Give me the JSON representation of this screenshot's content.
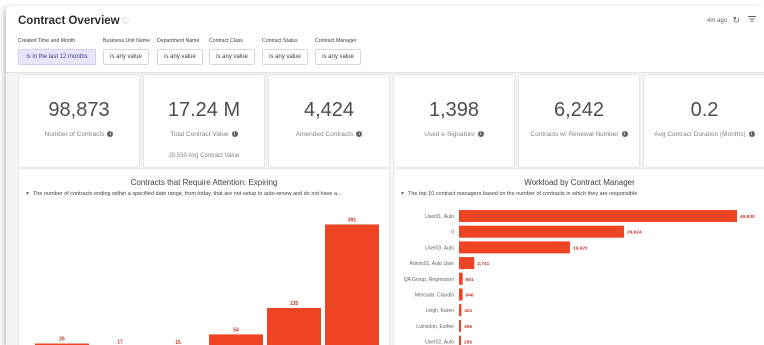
{
  "header": {
    "title": "Contract Overview",
    "heart_icon": "heart-icon",
    "updated": "4m ago",
    "refresh_icon": "refresh-icon",
    "filter_icon": "filter-icon"
  },
  "filters": [
    {
      "label": "Created Time and Month",
      "value": "is in the last 12 months",
      "active": true
    },
    {
      "label": "Business Unit Name",
      "value": "is any value",
      "active": false
    },
    {
      "label": "Department Name",
      "value": "is any value",
      "active": false
    },
    {
      "label": "Contract Class",
      "value": "is any value",
      "active": false
    },
    {
      "label": "Contract Status",
      "value": "is any value",
      "active": false
    },
    {
      "label": "Contract Manager",
      "value": "is any value",
      "active": false
    }
  ],
  "kpis": [
    {
      "value": "98,873",
      "label": "Number of Contracts"
    },
    {
      "value": "17.24 M",
      "label": "Total Contract Value",
      "sub": "20,550 Avg Contract Value"
    },
    {
      "value": "4,424",
      "label": "Amended Contracts"
    },
    {
      "value": "1,398",
      "label": "Used e-Signature"
    },
    {
      "value": "6,242",
      "label": "Contracts w/ Renewal Number"
    },
    {
      "value": "0.2",
      "label": "Avg Contract Duration (Months)"
    }
  ],
  "colors": {
    "accent": "#ee4423",
    "filter_active_bg": "#e8e6fb"
  },
  "chart_data": [
    {
      "type": "bar",
      "title": "Contracts that Require Attention: Expiring",
      "subtitle": "The number of contracts ending within a specified date range, from today, that are not setup to auto-renew and do not have a...",
      "categories": [
        "",
        "",
        "",
        "",
        "",
        ""
      ],
      "values": [
        26,
        17,
        15,
        54,
        135,
        391
      ],
      "ylim": [
        0,
        420
      ]
    },
    {
      "type": "bar",
      "orientation": "horizontal",
      "title": "Workload by Contract Manager",
      "subtitle": "The top 10 contract managers based on the number of contracts in which they are responsible",
      "categories": [
        "User01, Auto",
        "0",
        "User03, Auto",
        "Admin01, Auto User",
        "QA Group, Regression",
        "Mercado, Claudia",
        "Leigh, Karen",
        "Lumsdon, Esther",
        "User02, Auto"
      ],
      "values": [
        49930,
        29624,
        19920,
        2741,
        661,
        646,
        421,
        356,
        256
      ],
      "value_labels": [
        "49,930",
        "29,624",
        "19,920",
        "2,741",
        "661",
        "646",
        "421",
        "356",
        "256"
      ]
    }
  ]
}
